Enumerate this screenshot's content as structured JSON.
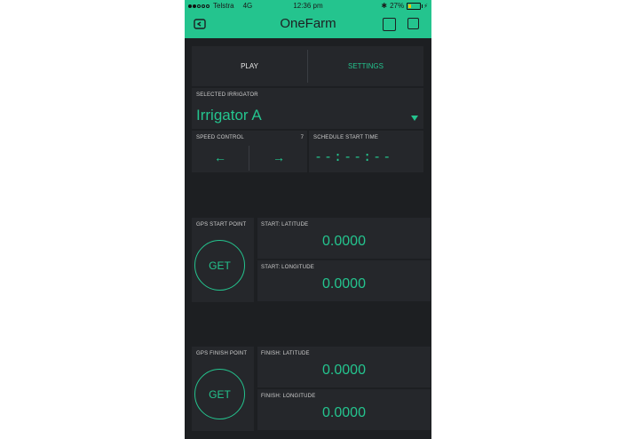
{
  "status": {
    "carrier": "Telstra",
    "network": "4G",
    "time": "12:36 pm",
    "battery": "27%",
    "battery_level": 0.27
  },
  "appbar": {
    "title": "OneFarm",
    "icons": [
      "back-icon",
      "chip-icon",
      "square-icon"
    ]
  },
  "tabs": [
    {
      "label": "PLAY"
    },
    {
      "label": "SETTINGS"
    }
  ],
  "irrigator": {
    "label": "SELECTED IRRIGATOR",
    "value": "Irrigator A"
  },
  "speed": {
    "label": "SPEED CONTROL",
    "value": "7",
    "left_glyph": "←",
    "right_glyph": "→"
  },
  "schedule": {
    "label": "SCHEDULE START TIME",
    "value": "--:--:--"
  },
  "gps_start": {
    "label": "GPS START POINT",
    "button": "GET",
    "latitude_label": "START: LATITUDE",
    "latitude": "0.0000",
    "longitude_label": "START: LONGITUDE",
    "longitude": "0.0000"
  },
  "gps_finish": {
    "label": "GPS FINISH POINT",
    "button": "GET",
    "latitude_label": "FINISH: LATITUDE",
    "latitude": "0.0000",
    "longitude_label": "FINISH: LONGITUDE",
    "longitude": "0.0000"
  },
  "colors": {
    "accent": "#24c48e",
    "background": "#1d1f22",
    "panel": "#25272b"
  }
}
